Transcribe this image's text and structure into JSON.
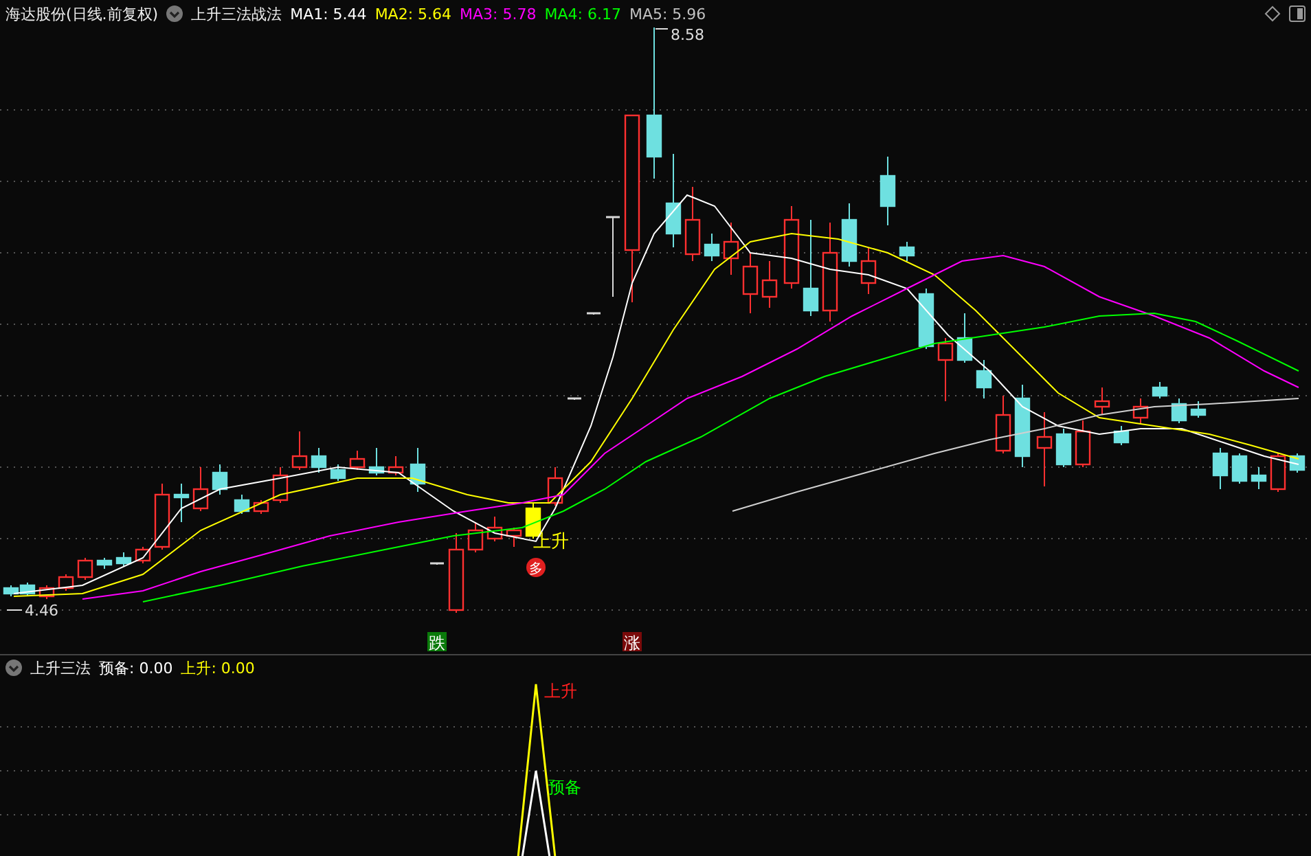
{
  "header": {
    "stock": "海达股份(日线.前复权)",
    "indicator": "上升三法战法",
    "ma": [
      {
        "label": "MA1:",
        "value": "5.44",
        "color": "#ffffff"
      },
      {
        "label": "MA2:",
        "value": "5.64",
        "color": "#ffff00"
      },
      {
        "label": "MA3:",
        "value": "5.78",
        "color": "#ff00ff"
      },
      {
        "label": "MA4:",
        "value": "6.17",
        "color": "#00ff00"
      },
      {
        "label": "MA5:",
        "value": "5.96",
        "color": "#c0c0c0"
      }
    ]
  },
  "main_chart": {
    "high_label": "8.58",
    "low_label": "4.46",
    "signal_label": "上升",
    "signal_badge": "多",
    "fall_badge": "跌",
    "rise_badge": "涨"
  },
  "sub_panel": {
    "title": "上升三法",
    "items": [
      {
        "label": "预备:",
        "value": "0.00",
        "color": "#ffffff"
      },
      {
        "label": "上升:",
        "value": "0.00",
        "color": "#ffff00"
      }
    ],
    "peak_labels": [
      {
        "text": "上升",
        "color": "#ff2020"
      },
      {
        "text": "预备",
        "color": "#00ff00"
      }
    ]
  }
}
